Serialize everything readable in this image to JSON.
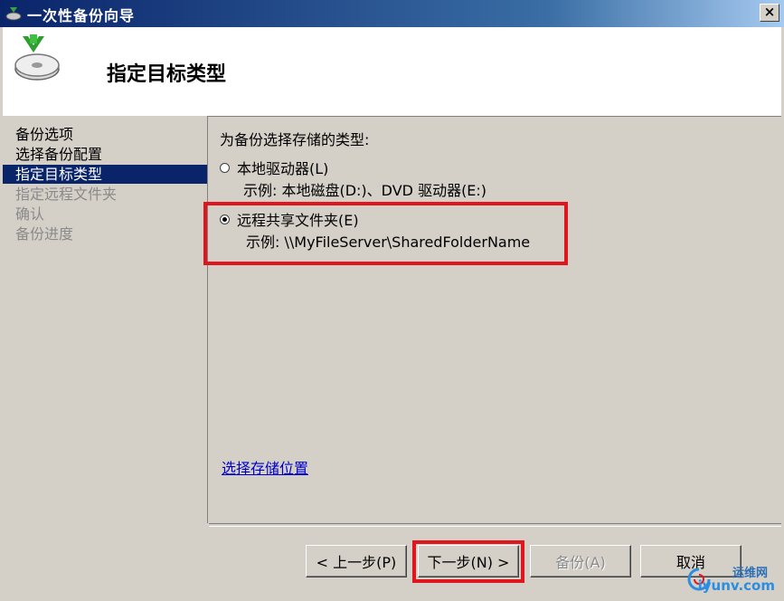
{
  "window": {
    "title": "一次性备份向导",
    "close_glyph": "×"
  },
  "header": {
    "heading": "指定目标类型"
  },
  "nav": {
    "items": [
      {
        "label": "备份选项",
        "state": "done"
      },
      {
        "label": "选择备份配置",
        "state": "done"
      },
      {
        "label": "指定目标类型",
        "state": "current"
      },
      {
        "label": "指定远程文件夹",
        "state": "pending"
      },
      {
        "label": "确认",
        "state": "pending"
      },
      {
        "label": "备份进度",
        "state": "pending"
      }
    ]
  },
  "content": {
    "prompt": "为备份选择存储的类型:",
    "options": [
      {
        "label": "本地驱动器(L)",
        "example": "示例: 本地磁盘(D:)、DVD 驱动器(E:)",
        "checked": false
      },
      {
        "label": "远程共享文件夹(E)",
        "example": "示例: \\\\MyFileServer\\SharedFolderName",
        "checked": true
      }
    ],
    "link": "选择存储位置"
  },
  "buttons": {
    "prev": "< 上一步(P)",
    "next": "下一步(N) >",
    "backup": "备份(A)",
    "cancel": "取消"
  },
  "watermark": {
    "line1": "运维网",
    "line2": "iyunv.com"
  },
  "colors": {
    "highlight": "#e0161e",
    "selection": "#0a246a",
    "link": "#0000cc"
  }
}
